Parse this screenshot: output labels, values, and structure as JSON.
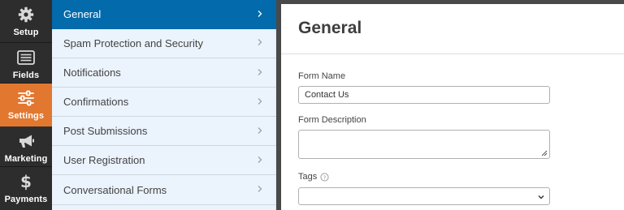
{
  "iconbar": {
    "items": [
      {
        "label": "Setup",
        "icon": "gear-icon"
      },
      {
        "label": "Fields",
        "icon": "fields-list-icon"
      },
      {
        "label": "Settings",
        "icon": "sliders-icon",
        "active": true
      },
      {
        "label": "Marketing",
        "icon": "megaphone-icon"
      },
      {
        "label": "Payments",
        "icon": "dollar-icon"
      }
    ]
  },
  "panel": {
    "items": [
      {
        "label": "General",
        "active": true
      },
      {
        "label": "Spam Protection and Security"
      },
      {
        "label": "Notifications"
      },
      {
        "label": "Confirmations"
      },
      {
        "label": "Post Submissions"
      },
      {
        "label": "User Registration"
      },
      {
        "label": "Conversational Forms"
      }
    ]
  },
  "main": {
    "title": "General",
    "form_name": {
      "label": "Form Name",
      "value": "Contact Us"
    },
    "form_description": {
      "label": "Form Description",
      "value": ""
    },
    "tags": {
      "label": "Tags",
      "value": ""
    }
  },
  "colors": {
    "accent_orange": "#e27730",
    "active_blue": "#036aab",
    "panel_bg": "#ebf3fc",
    "iconbar_bg": "#2d2d2d"
  }
}
